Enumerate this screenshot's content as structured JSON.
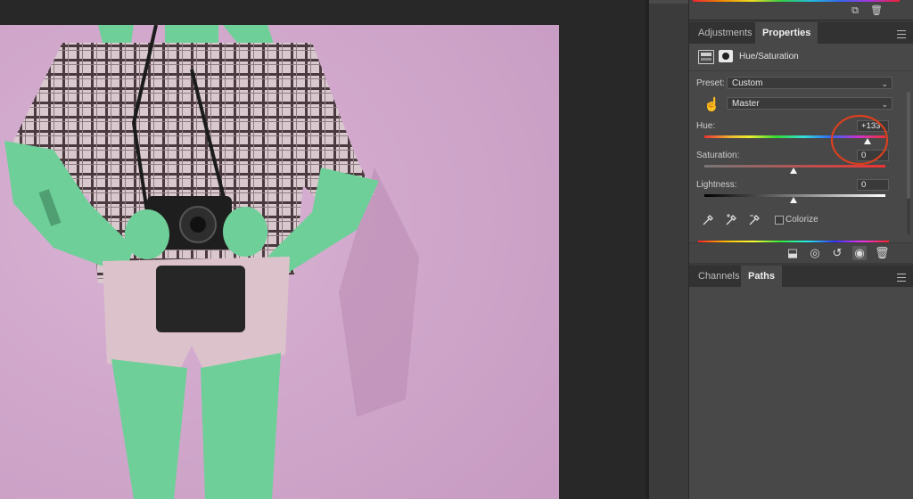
{
  "properties_panel": {
    "tabs": [
      "Adjustments",
      "Properties"
    ],
    "active_tab": "Properties",
    "adjustment_name": "Hue/Saturation",
    "preset_label": "Preset:",
    "preset_value": "Custom",
    "channel_value": "Master",
    "hue_label": "Hue:",
    "hue_value": "+133",
    "saturation_label": "Saturation:",
    "saturation_value": "0",
    "lightness_label": "Lightness:",
    "lightness_value": "0",
    "colorize_label": "Colorize"
  },
  "channels_panel": {
    "tabs": [
      "Channels",
      "Paths"
    ],
    "active_tab": "Paths"
  },
  "icons": {
    "adjustment_type": "hue-saturation-icon",
    "mask": "layer-mask-icon",
    "targeted_adjustment": "hand-icon",
    "eyedroppers": [
      "eyedropper-icon",
      "eyedropper-plus-icon",
      "eyedropper-minus-icon"
    ],
    "footer": [
      "clip-to-layer-icon",
      "view-previous-icon",
      "reset-icon",
      "visibility-eye-icon",
      "trash-icon"
    ]
  },
  "colors": {
    "annotation_circle": "#d8401f",
    "photo_background": "#d2a9ce",
    "skin_tint": "#6fcf98"
  }
}
